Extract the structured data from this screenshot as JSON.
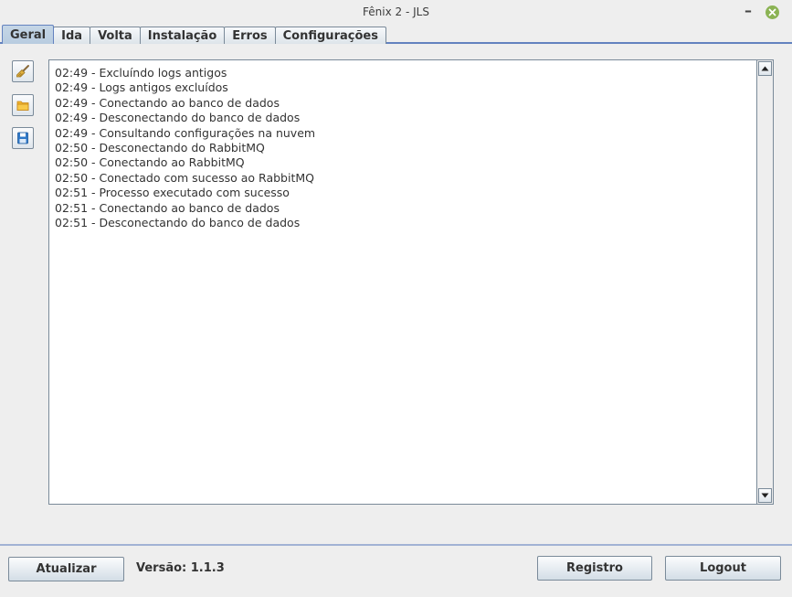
{
  "window": {
    "title": "Fênix 2 - JLS",
    "minimize_glyph": "–",
    "close_icon": "close-icon"
  },
  "tabs": [
    {
      "label": "Geral",
      "active": true
    },
    {
      "label": "Ida",
      "active": false
    },
    {
      "label": "Volta",
      "active": false
    },
    {
      "label": "Instalação",
      "active": false
    },
    {
      "label": "Erros",
      "active": false
    },
    {
      "label": "Configurações",
      "active": false
    }
  ],
  "toolbar": {
    "icons": [
      "broom-icon",
      "folder-icon",
      "save-icon"
    ]
  },
  "log": {
    "lines": [
      "02:49 - Excluíndo logs antigos",
      "02:49 - Logs antigos excluídos",
      "02:49 - Conectando ao banco de dados",
      "02:49 - Desconectando do banco de dados",
      "02:49 - Consultando configurações na nuvem",
      "02:50 - Desconectando do RabbitMQ",
      "02:50 - Conectando ao RabbitMQ",
      "02:50 - Conectado com sucesso ao RabbitMQ",
      "02:51 - Processo executado com sucesso",
      "02:51 - Conectando ao banco de dados",
      "02:51 - Desconectando do banco de dados"
    ]
  },
  "footer": {
    "refresh_label": "Atualizar",
    "version_text": "Versão: 1.1.3",
    "register_label": "Registro",
    "logout_label": "Logout"
  },
  "colors": {
    "accent": "#6382bf",
    "close_button": "#8bb354",
    "background": "#eeeeee"
  }
}
